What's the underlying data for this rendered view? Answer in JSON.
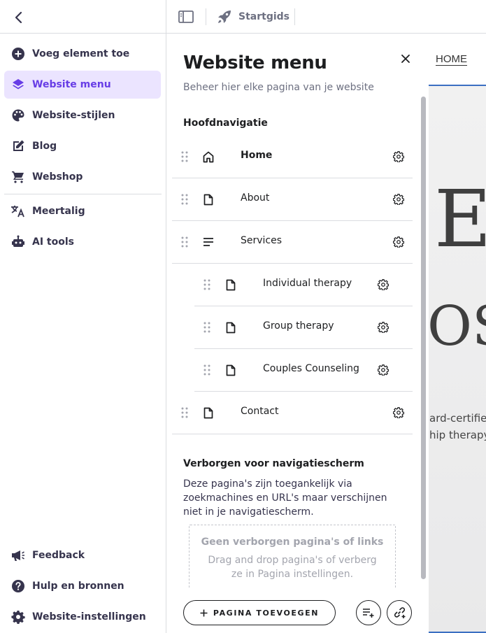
{
  "sidebar": {
    "items": [
      {
        "label": "Voeg element toe",
        "icon": "plus-circle-icon"
      },
      {
        "label": "Website menu",
        "icon": "layers-icon"
      },
      {
        "label": "Website-stijlen",
        "icon": "palette-icon"
      },
      {
        "label": "Blog",
        "icon": "edit-icon"
      },
      {
        "label": "Webshop",
        "icon": "cart-icon"
      },
      {
        "label": "Meertalig",
        "icon": "translate-icon"
      },
      {
        "label": "AI tools",
        "icon": "robot-icon"
      }
    ],
    "bottom_items": [
      {
        "label": "Feedback",
        "icon": "megaphone-icon"
      },
      {
        "label": "Hulp en bronnen",
        "icon": "help-icon"
      },
      {
        "label": "Website-instellingen",
        "icon": "gear-icon"
      }
    ],
    "active_index": 1,
    "accent_color": "#673de6"
  },
  "topbar": {
    "start_guide_label": "Startgids"
  },
  "panel": {
    "title": "Website menu",
    "subtitle": "Beheer hier elke pagina van je website",
    "main_nav_title": "Hoofdnavigatie",
    "pages": [
      {
        "label": "Home",
        "icon": "home-icon",
        "level": 0,
        "is_home": true
      },
      {
        "label": "About",
        "icon": "page-icon",
        "level": 0
      },
      {
        "label": "Services",
        "icon": "lines-icon",
        "level": 0
      },
      {
        "label": "Individual therapy",
        "icon": "page-icon",
        "level": 1
      },
      {
        "label": "Group therapy",
        "icon": "page-icon",
        "level": 1
      },
      {
        "label": "Couples Counseling",
        "icon": "page-icon",
        "level": 1
      },
      {
        "label": "Contact",
        "icon": "page-icon",
        "level": 0
      }
    ],
    "hidden_title": "Verborgen voor navigatiescherm",
    "hidden_description": "Deze pagina's zijn toegankelijk via zoekmachines en URL's maar verschijnen niet in je navigatiescherm.",
    "empty_title": "Geen verborgen pagina's of links",
    "empty_text": "Drag and drop pagina's of verberg ze in Pagina instellingen.",
    "add_page_label": "PAGINA TOEVOEGEN"
  },
  "preview": {
    "nav_label": "HOME",
    "big_text_1": "E",
    "big_text_2": "OS",
    "text_line_1": "ard-certified",
    "text_line_2": "hip therapy."
  }
}
